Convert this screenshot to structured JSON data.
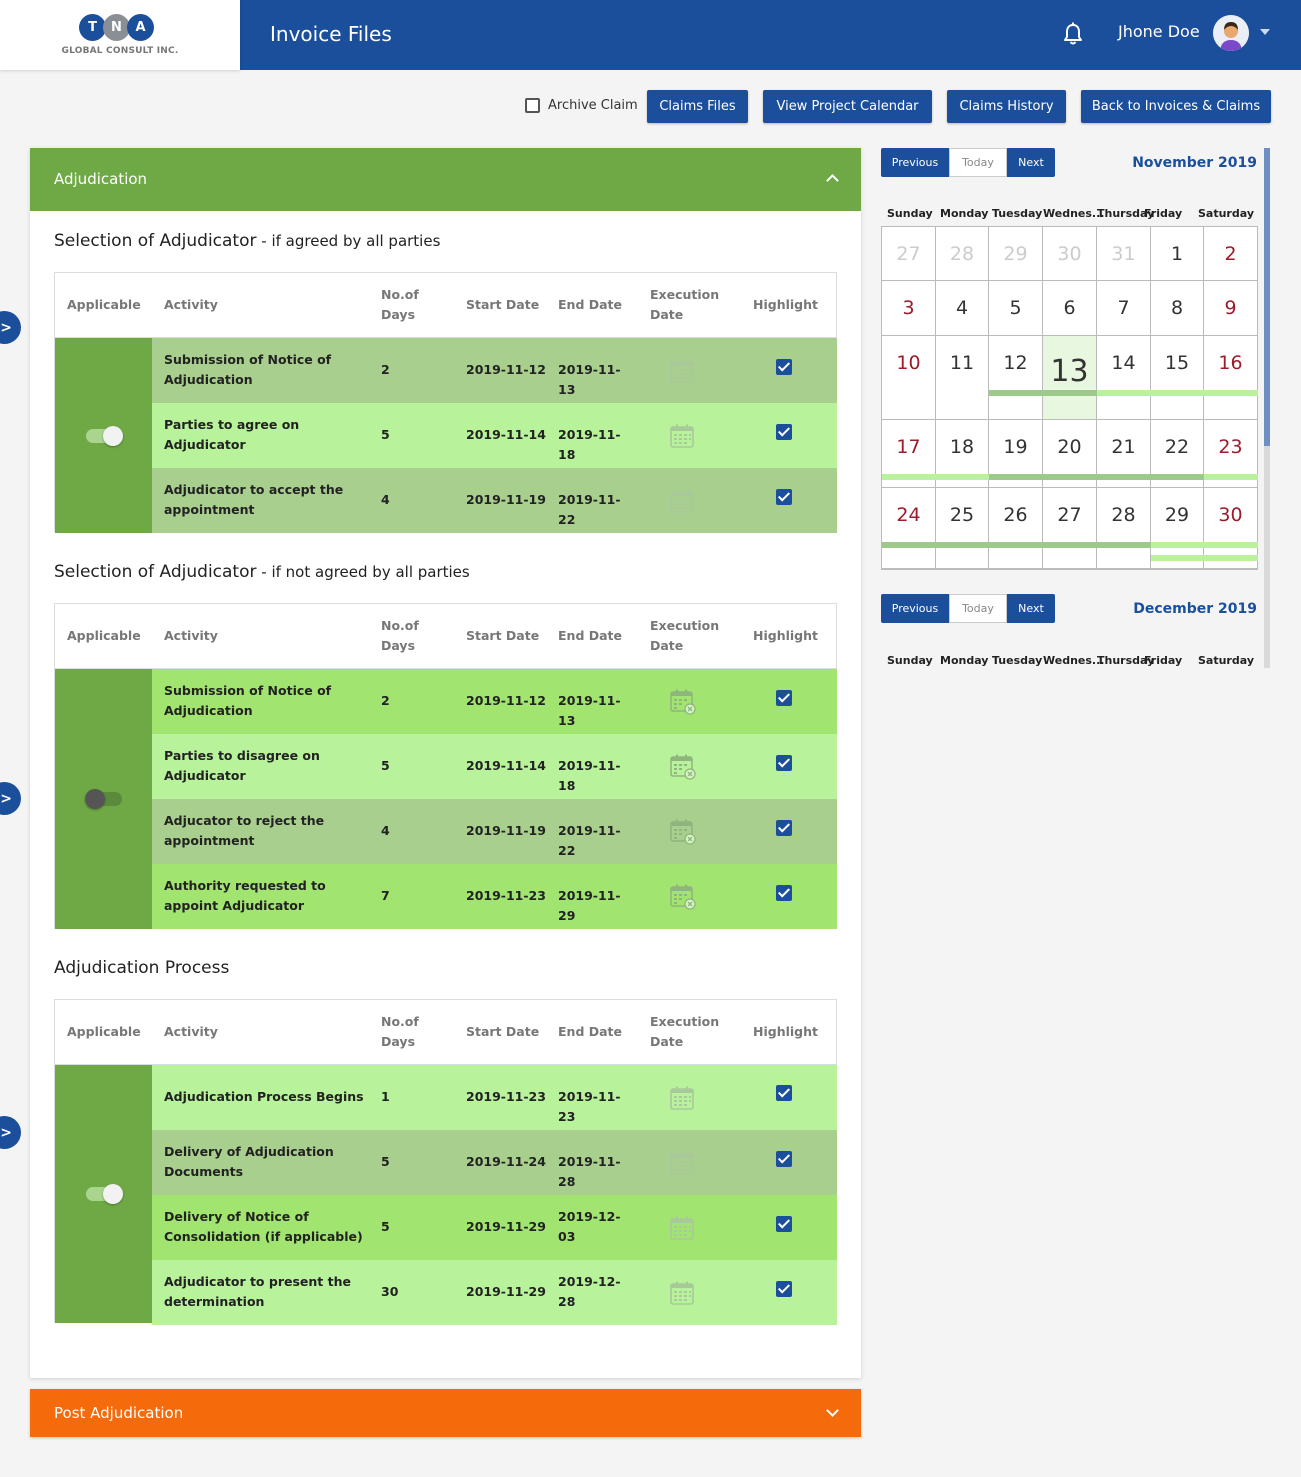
{
  "header": {
    "logo_letters": [
      "T",
      "N",
      "A"
    ],
    "logo_subtitle": "GLOBAL CONSULT INC.",
    "title": "Invoice Files",
    "user_name": "Jhone Doe"
  },
  "toolbar": {
    "archive_label": "Archive Claim",
    "buttons": [
      "Claims Files",
      "View Project Calendar",
      "Claims History",
      "Back to Invoices & Claims"
    ]
  },
  "panel": {
    "title": "Adjudication",
    "columns": {
      "applicable": "Applicable",
      "activity": "Activity",
      "days_line1": "No.of",
      "days_line2": "Days",
      "start": "Start Date",
      "end": "End Date",
      "exec_line1": "Execution",
      "exec_line2": "Date",
      "highlight": "Highlight"
    },
    "sections": [
      {
        "title": "Selection of Adjudicator",
        "subtitle": " - if agreed by all parties",
        "toggle_on": true,
        "rows": [
          {
            "activity": "Submission of Notice of Adjudication",
            "days": "2",
            "start": "2019-11-12",
            "end": "2019-11-13",
            "highlight": true
          },
          {
            "activity": "Parties to agree on Adjudicator",
            "days": "5",
            "start": "2019-11-14",
            "end": "2019-11-18",
            "highlight": true
          },
          {
            "activity": "Adjudicator to accept the appointment",
            "days": "4",
            "start": "2019-11-19",
            "end": "2019-11-22",
            "highlight": true
          }
        ]
      },
      {
        "title": "Selection of Adjudicator",
        "subtitle": " - if not agreed by all parties",
        "toggle_on": false,
        "rows": [
          {
            "activity": "Submission of Notice of Adjudication",
            "days": "2",
            "start": "2019-11-12",
            "end": "2019-11-13",
            "highlight": true
          },
          {
            "activity": "Parties to disagree on Adjudicator",
            "days": "5",
            "start": "2019-11-14",
            "end": "2019-11-18",
            "highlight": true
          },
          {
            "activity": "Adjucator to reject the appointment",
            "days": "4",
            "start": "2019-11-19",
            "end": "2019-11-22",
            "highlight": true
          },
          {
            "activity": "Authority requested to appoint Adjudicator",
            "days": "7",
            "start": "2019-11-23",
            "end": "2019-11-29",
            "highlight": true
          }
        ]
      },
      {
        "title": "Adjudication Process",
        "subtitle": "",
        "toggle_on": true,
        "rows": [
          {
            "activity": "Adjudication Process Begins",
            "days": "1",
            "start": "2019-11-23",
            "end": "2019-11-23",
            "highlight": true
          },
          {
            "activity": "Delivery of Adjudication Documents",
            "days": "5",
            "start": "2019-11-24",
            "end": "2019-11-28",
            "highlight": true
          },
          {
            "activity": "Delivery of Notice of Consolidation (if applicable)",
            "days": "5",
            "start": "2019-11-29",
            "end": "2019-12-03",
            "highlight": true
          },
          {
            "activity": "Adjudicator to present the determination",
            "days": "30",
            "start": "2019-11-29",
            "end": "2019-12-28",
            "highlight": true
          }
        ]
      }
    ]
  },
  "post_panel": {
    "title": "Post Adjudication"
  },
  "calendar": {
    "nav": {
      "previous": "Previous",
      "today": "Today",
      "next": "Next"
    },
    "weekdays": [
      "Sunday",
      "Monday",
      "Tuesday",
      "Wednes...",
      "Thursday",
      "Friday",
      "Saturday"
    ],
    "months": [
      {
        "title": "November 2019",
        "weeks": [
          [
            "27",
            "28",
            "29",
            "30",
            "31",
            "1",
            "2"
          ],
          [
            "3",
            "4",
            "5",
            "6",
            "7",
            "8",
            "9"
          ],
          [
            "10",
            "11",
            "12",
            "13",
            "14",
            "15",
            "16"
          ],
          [
            "17",
            "18",
            "19",
            "20",
            "21",
            "22",
            "23"
          ],
          [
            "24",
            "25",
            "26",
            "27",
            "28",
            "29",
            "30"
          ]
        ],
        "today": "13"
      },
      {
        "title": "December 2019"
      }
    ],
    "colors": {
      "weekend": "#9b1c2a",
      "muted": "#cccccc",
      "today_bg": "#e8f8e0",
      "bar_dark": "#9dc98a",
      "bar_light": "#b9f29a"
    }
  },
  "colors": {
    "primary": "#1b4f9c",
    "section_green": "#6ea945",
    "post_orange": "#f56a0b"
  }
}
